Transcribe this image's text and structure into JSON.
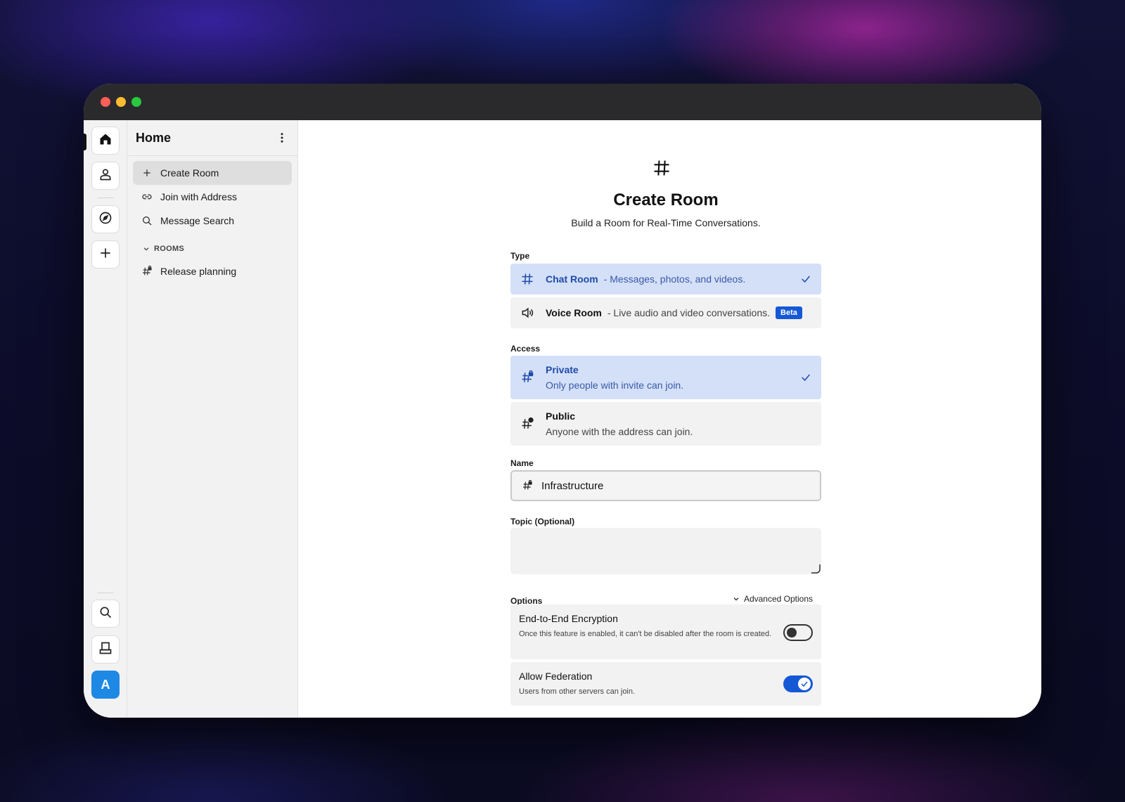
{
  "sidebar": {
    "title": "Home",
    "items": [
      {
        "label": "Create Room"
      },
      {
        "label": "Join with Address"
      },
      {
        "label": "Message Search"
      }
    ],
    "rooms_heading": "ROOMS",
    "rooms": [
      {
        "label": "Release planning"
      }
    ]
  },
  "rail": {
    "avatar_letter": "A"
  },
  "main": {
    "title": "Create Room",
    "subtitle": "Build a Room for Real-Time Conversations.",
    "type_label": "Type",
    "types": [
      {
        "name": "Chat Room",
        "desc": "- Messages, photos, and videos.",
        "selected": true
      },
      {
        "name": "Voice Room",
        "desc": "- Live audio and video conversations.",
        "badge": "Beta",
        "selected": false
      }
    ],
    "access_label": "Access",
    "access": [
      {
        "name": "Private",
        "desc": "Only people with invite can join.",
        "selected": true
      },
      {
        "name": "Public",
        "desc": "Anyone with the address can join.",
        "selected": false
      }
    ],
    "name_label": "Name",
    "name_value": "Infrastructure",
    "topic_label": "Topic (Optional)",
    "topic_value": "",
    "options_label": "Options",
    "advanced_label": "Advanced Options",
    "options": [
      {
        "title": "End-to-End Encryption",
        "desc": "Once this feature is enabled, it can't be disabled after the room is created.",
        "enabled": false
      },
      {
        "title": "Allow Federation",
        "desc": "Users from other servers can join.",
        "enabled": true
      }
    ]
  },
  "colors": {
    "accent": "#1558d6",
    "selected_bg": "#d4e0f8",
    "selected_text": "#1f4aa8",
    "avatar": "#1e88e5"
  }
}
